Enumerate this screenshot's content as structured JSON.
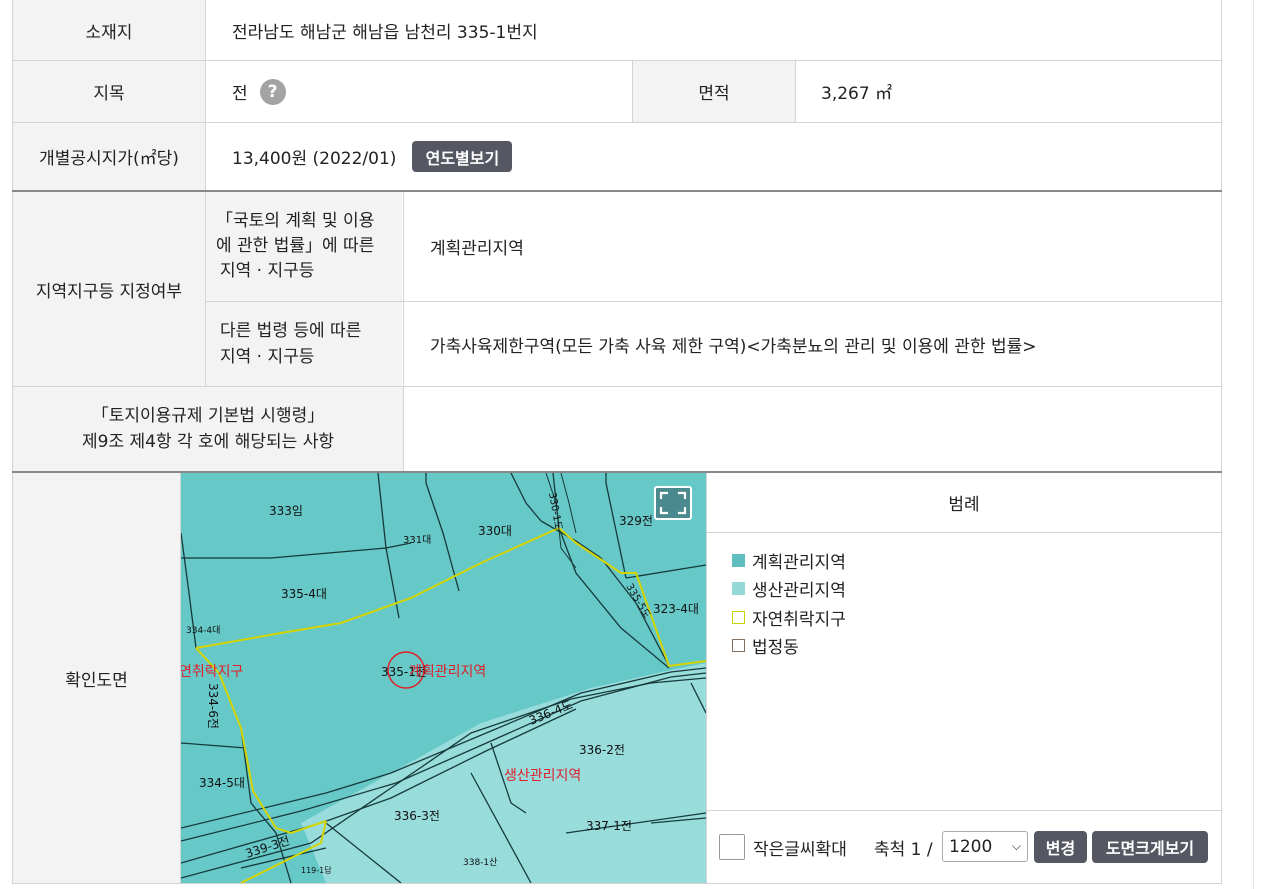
{
  "rows": {
    "location": {
      "label": "소재지",
      "value": "전라남도 해남군 해남읍 남천리 335-1번지"
    },
    "land_category": {
      "label": "지목",
      "value": "전",
      "help_icon": "question-icon",
      "area_label": "면적",
      "area_value": "3,267 ㎡"
    },
    "official_price": {
      "label": "개별공시지가(㎡당)",
      "value": "13,400원 (2022/01)",
      "button": "연도별보기"
    },
    "zoning": {
      "label": "지역지구등 지정여부",
      "sub1_label_lines": [
        "「국토의 계획 및 이용",
        "에 관한 법률」에 따른",
        "지역 · 지구등"
      ],
      "sub1_value": "계획관리지역",
      "sub2_label_lines": [
        "다른 법령 등에 따른",
        "지역 · 지구등"
      ],
      "sub2_value": "가축사육제한구역(모든 가축 사육 제한 구역)<가축분뇨의 관리 및 이용에 관한 법률>"
    },
    "enforcement": {
      "label_lines": [
        "「토지이용규제 기본법 시행령」",
        "제9조 제4항 각 호에 해당되는 사항"
      ],
      "value": ""
    },
    "map_row": {
      "label": "확인도면"
    }
  },
  "map": {
    "expand_icon": "fullscreen-icon",
    "parcel_labels": [
      "333임",
      "331대",
      "330대",
      "330-1도",
      "329전",
      "335-4대",
      "323-4대",
      "335-5도",
      "334-4대",
      "335-1전",
      "334-6전",
      "336-4도",
      "336-2전",
      "334-5대",
      "336-3전",
      "337-1전",
      "339-3전",
      "338-1산",
      "119-1답"
    ],
    "zone_labels": [
      "연취락지구",
      "계획관리지역",
      "생산관리지역"
    ],
    "colors": {
      "planned_zone": "#67c8c8",
      "production_zone": "#94dcdc",
      "village_boundary": "#d4d400",
      "red_text": "#e0202a"
    }
  },
  "legend": {
    "title": "범례",
    "items": [
      {
        "label": "계획관리지역",
        "color": "#5fbfc0",
        "filled": true
      },
      {
        "label": "생산관리지역",
        "color": "#96d9d9",
        "filled": true
      },
      {
        "label": "자연취락지구",
        "color": "#c8d400",
        "filled": false
      },
      {
        "label": "법정동",
        "color": "#8a7060",
        "filled": false
      }
    ]
  },
  "controls": {
    "small_text_label": "작은글씨확대",
    "scale_label": "축척 1 /",
    "scale_value": "1200",
    "change_button": "변경",
    "bigmap_button": "도면크게보기"
  }
}
